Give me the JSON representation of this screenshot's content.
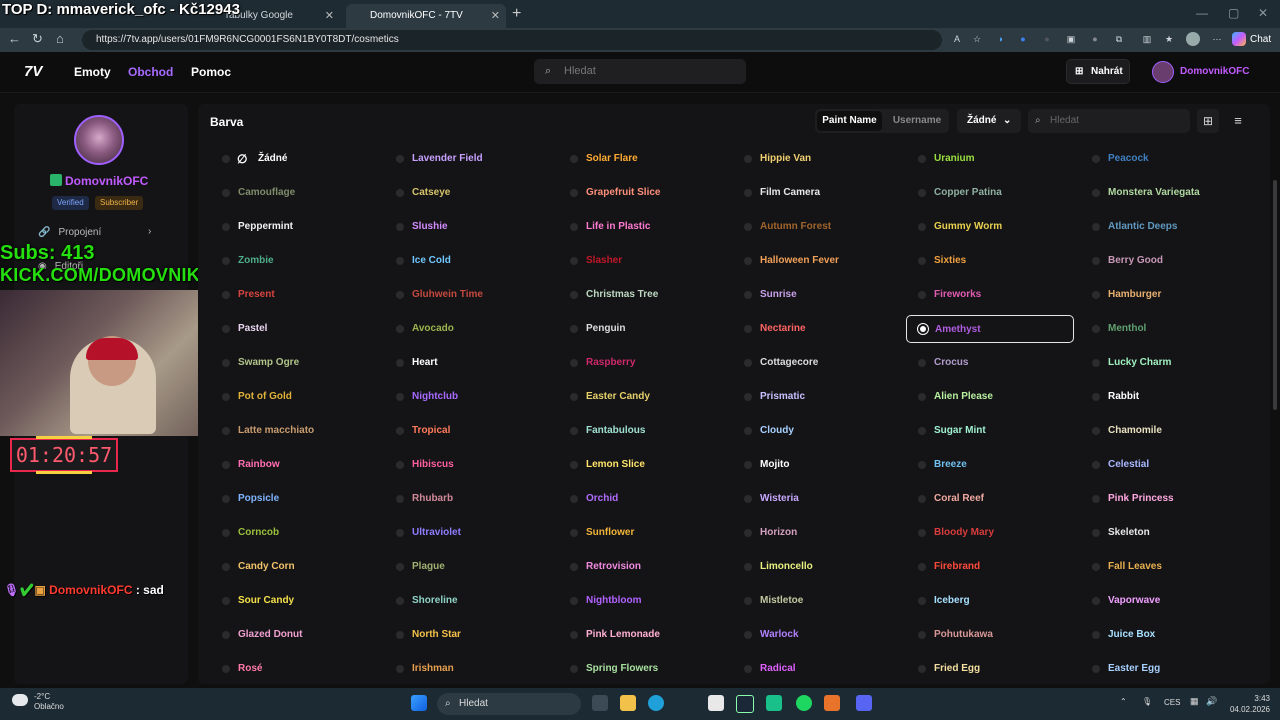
{
  "overlay": {
    "top_text": "TOP D: mmaverick_ofc - Kč12943",
    "subs": "Subs: 413",
    "kick": "KICK.COM/DOMOVNIKOFC",
    "timer": "01:20:57",
    "chat_user": "DomovnikOFC",
    "chat_sep": " : ",
    "chat_msg": "sad"
  },
  "browser": {
    "tabs": [
      {
        "label": "Tabulky Google"
      },
      {
        "label": "DomovnikOFC - 7TV"
      }
    ],
    "url": "https://7tv.app/users/01FM9R6NCG0001FS6N1BY0T8DT/cosmetics",
    "chat_label": "Chat"
  },
  "site": {
    "nav": [
      "Emoty",
      "Obchod",
      "Pomoc"
    ],
    "search_placeholder": "Hledat",
    "upload_label": "Nahrát",
    "user_label": "DomovnikOFC"
  },
  "profile": {
    "name": "DomovnikOFC",
    "badges": [
      "Verified",
      "Subscriber"
    ],
    "menu": [
      "Propojení",
      "Editoři"
    ]
  },
  "cosmetics": {
    "section_title": "Barva",
    "tabs": [
      "Paint Name",
      "Username"
    ],
    "filter_label": "Žádné",
    "search_placeholder": "Hledat",
    "columns": [
      [
        {
          "name": "Žádné",
          "color": "#ffffff"
        },
        {
          "name": "Camouflage",
          "color": "#7d8c6a"
        },
        {
          "name": "Peppermint",
          "color": "#f2f2f2"
        },
        {
          "name": "Zombie",
          "color": "#4fae8a"
        },
        {
          "name": "Present",
          "color": "#d8443f"
        },
        {
          "name": "Pastel",
          "color": "#e8d6f0"
        },
        {
          "name": "Swamp Ogre",
          "color": "#b0c48a"
        },
        {
          "name": "Pot of Gold",
          "color": "#e0b23a"
        },
        {
          "name": "Latte macchiato",
          "color": "#c89c6f"
        },
        {
          "name": "Rainbow",
          "color": "#ff6fb1"
        },
        {
          "name": "Popsicle",
          "color": "#7fb4ff"
        },
        {
          "name": "Corncob",
          "color": "#9ac03c"
        },
        {
          "name": "Candy Corn",
          "color": "#f2c36a"
        },
        {
          "name": "Sour Candy",
          "color": "#f4e04a"
        },
        {
          "name": "Glazed Donut",
          "color": "#f0a0d0"
        },
        {
          "name": "Rosé",
          "color": "#ff7aa8"
        }
      ],
      [
        {
          "name": "Lavender Field",
          "color": "#c8a0ff"
        },
        {
          "name": "Catseye",
          "color": "#d6c36a"
        },
        {
          "name": "Slushie",
          "color": "#d28cff"
        },
        {
          "name": "Ice Cold",
          "color": "#6fc7ff"
        },
        {
          "name": "Gluhwein Time",
          "color": "#c5483f"
        },
        {
          "name": "Avocado",
          "color": "#9cb34e"
        },
        {
          "name": "Heart",
          "color": "#ffffff"
        },
        {
          "name": "Nightclub",
          "color": "#a86bff"
        },
        {
          "name": "Tropical",
          "color": "#ff7a5a"
        },
        {
          "name": "Hibiscus",
          "color": "#ff5fa0"
        },
        {
          "name": "Rhubarb",
          "color": "#d08a9a"
        },
        {
          "name": "Ultraviolet",
          "color": "#8f7cff"
        },
        {
          "name": "Plague",
          "color": "#9fb070"
        },
        {
          "name": "Shoreline",
          "color": "#8fd3c8"
        },
        {
          "name": "North Star",
          "color": "#f5c04a"
        },
        {
          "name": "Irishman",
          "color": "#e8a050"
        }
      ],
      [
        {
          "name": "Solar Flare",
          "color": "#ffaa33"
        },
        {
          "name": "Grapefruit Slice",
          "color": "#ff8f7a"
        },
        {
          "name": "Life in Plastic",
          "color": "#ff7ad0"
        },
        {
          "name": "Slasher",
          "color": "#c01828"
        },
        {
          "name": "Christmas Tree",
          "color": "#bcd9c0"
        },
        {
          "name": "Penguin",
          "color": "#dddddd"
        },
        {
          "name": "Raspberry",
          "color": "#d0286c"
        },
        {
          "name": "Easter Candy",
          "color": "#e6d06a"
        },
        {
          "name": "Fantabulous",
          "color": "#9fe0d0"
        },
        {
          "name": "Lemon Slice",
          "color": "#ffe36a"
        },
        {
          "name": "Orchid",
          "color": "#b06cff"
        },
        {
          "name": "Sunflower",
          "color": "#f0b43a"
        },
        {
          "name": "Retrovision",
          "color": "#f08ae0"
        },
        {
          "name": "Nightbloom",
          "color": "#b062ff"
        },
        {
          "name": "Pink Lemonade",
          "color": "#ffb0d2"
        },
        {
          "name": "Spring Flowers",
          "color": "#a8e0a0"
        }
      ],
      [
        {
          "name": "Hippie Van",
          "color": "#f0d070"
        },
        {
          "name": "Film Camera",
          "color": "#e8e8e8"
        },
        {
          "name": "Autumn Forest",
          "color": "#a0642c"
        },
        {
          "name": "Halloween Fever",
          "color": "#f0a058"
        },
        {
          "name": "Sunrise",
          "color": "#c8a0e8"
        },
        {
          "name": "Nectarine",
          "color": "#ff6464"
        },
        {
          "name": "Cottagecore",
          "color": "#dddddd"
        },
        {
          "name": "Prismatic",
          "color": "#c8c0ff"
        },
        {
          "name": "Cloudy",
          "color": "#a8d0ff"
        },
        {
          "name": "Mojito",
          "color": "#ffffff"
        },
        {
          "name": "Wisteria",
          "color": "#c8a8ff"
        },
        {
          "name": "Horizon",
          "color": "#d4a0c0"
        },
        {
          "name": "Limoncello",
          "color": "#e8f080"
        },
        {
          "name": "Mistletoe",
          "color": "#c4c7a0"
        },
        {
          "name": "Warlock",
          "color": "#b080ff"
        },
        {
          "name": "Radical",
          "color": "#e060ff"
        }
      ],
      [
        {
          "name": "Uranium",
          "color": "#9be040"
        },
        {
          "name": "Copper Patina",
          "color": "#8fb0a0"
        },
        {
          "name": "Gummy Worm",
          "color": "#e8d050"
        },
        {
          "name": "Sixties",
          "color": "#f0a040"
        },
        {
          "name": "Fireworks",
          "color": "#e05cb0"
        },
        {
          "name": "Amethyst",
          "color": "#b05ce0"
        },
        {
          "name": "Crocus",
          "color": "#b09ccc"
        },
        {
          "name": "Alien Please",
          "color": "#b8f0a0"
        },
        {
          "name": "Sugar Mint",
          "color": "#a0f0d0"
        },
        {
          "name": "Breeze",
          "color": "#70c0f0"
        },
        {
          "name": "Coral Reef",
          "color": "#f0a8a0"
        },
        {
          "name": "Bloody Mary",
          "color": "#d83c3c"
        },
        {
          "name": "Firebrand",
          "color": "#ff4a3a"
        },
        {
          "name": "Iceberg",
          "color": "#a8e0ff"
        },
        {
          "name": "Pohutukawa",
          "color": "#d89898"
        },
        {
          "name": "Fried Egg",
          "color": "#f4e0a0"
        }
      ],
      [
        {
          "name": "Peacock",
          "color": "#4080c0"
        },
        {
          "name": "Monstera Variegata",
          "color": "#b0d8a0"
        },
        {
          "name": "Atlantic Deeps",
          "color": "#6098c0"
        },
        {
          "name": "Berry Good",
          "color": "#c898b8"
        },
        {
          "name": "Hamburger",
          "color": "#e8b070"
        },
        {
          "name": "Menthol",
          "color": "#60a070"
        },
        {
          "name": "Lucky Charm",
          "color": "#a0f0c0"
        },
        {
          "name": "Rabbit",
          "color": "#ffffff"
        },
        {
          "name": "Chamomile",
          "color": "#e8e0c0"
        },
        {
          "name": "Celestial",
          "color": "#a8b8ff"
        },
        {
          "name": "Pink Princess",
          "color": "#ffa8e0"
        },
        {
          "name": "Skeleton",
          "color": "#e8e8e8"
        },
        {
          "name": "Fall Leaves",
          "color": "#e8b050"
        },
        {
          "name": "Vaporwave",
          "color": "#f0a0ff"
        },
        {
          "name": "Juice Box",
          "color": "#a8e0ff"
        },
        {
          "name": "Easter Egg",
          "color": "#a8d0ff"
        }
      ]
    ],
    "selected": "Amethyst"
  },
  "taskbar": {
    "weather_temp": "-2°C",
    "weather_desc": "Oblačno",
    "search_placeholder": "Hledat",
    "lang": "CES",
    "time": "3:43",
    "date": "04.02.2026"
  }
}
